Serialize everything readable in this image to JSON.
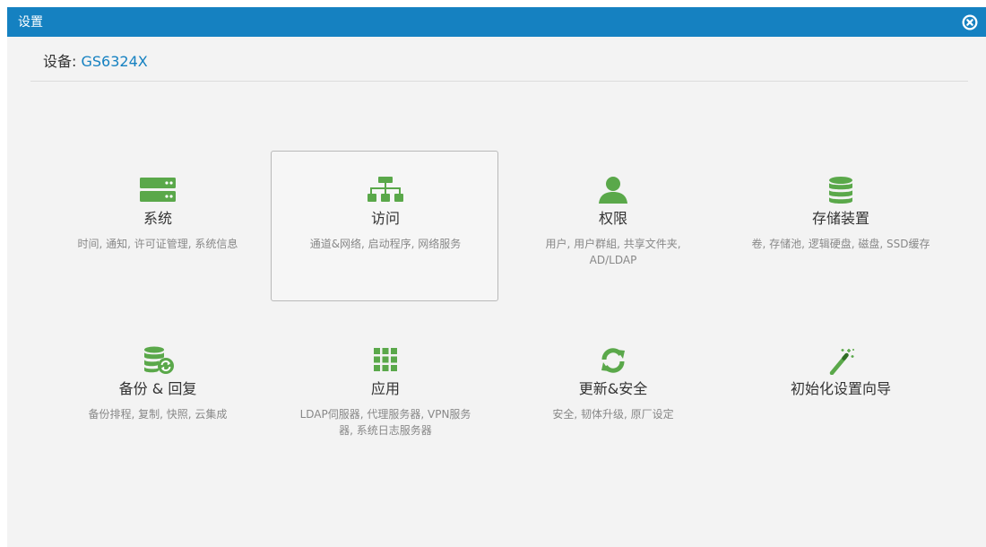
{
  "window": {
    "title": "设置",
    "close_icon": "close-icon"
  },
  "device": {
    "label": "设备:",
    "name": "GS6324X"
  },
  "colors": {
    "titlebar": "#1581c1",
    "icon_green": "#5aa84a",
    "device_name": "#1581c1"
  },
  "tiles": [
    {
      "label": "系统",
      "desc": "时间, 通知, 许可证管理, 系统信息",
      "icon": "server-icon"
    },
    {
      "label": "访问",
      "desc": "通道&网络, 启动程序, 网络服务",
      "icon": "network-icon",
      "selected": true
    },
    {
      "label": "权限",
      "desc": "用户, 用户群組, 共享文件夹, AD/LDAP",
      "icon": "user-icon"
    },
    {
      "label": "存储装置",
      "desc": "卷, 存储池, 逻辑硬盘, 磁盘, SSD缓存",
      "icon": "database-icon"
    },
    {
      "label": "备份 & 回复",
      "desc": "备份排程, 复制, 快照, 云集成",
      "icon": "backup-icon"
    },
    {
      "label": "应用",
      "desc": "LDAP伺服器, 代理服务器, VPN服务器, 系统日志服务器",
      "icon": "apps-grid-icon"
    },
    {
      "label": "更新&安全",
      "desc": "安全, 韧体升级, 原厂设定",
      "icon": "refresh-icon"
    },
    {
      "label": "初始化设置向导",
      "desc": "",
      "icon": "magic-wand-icon"
    }
  ]
}
